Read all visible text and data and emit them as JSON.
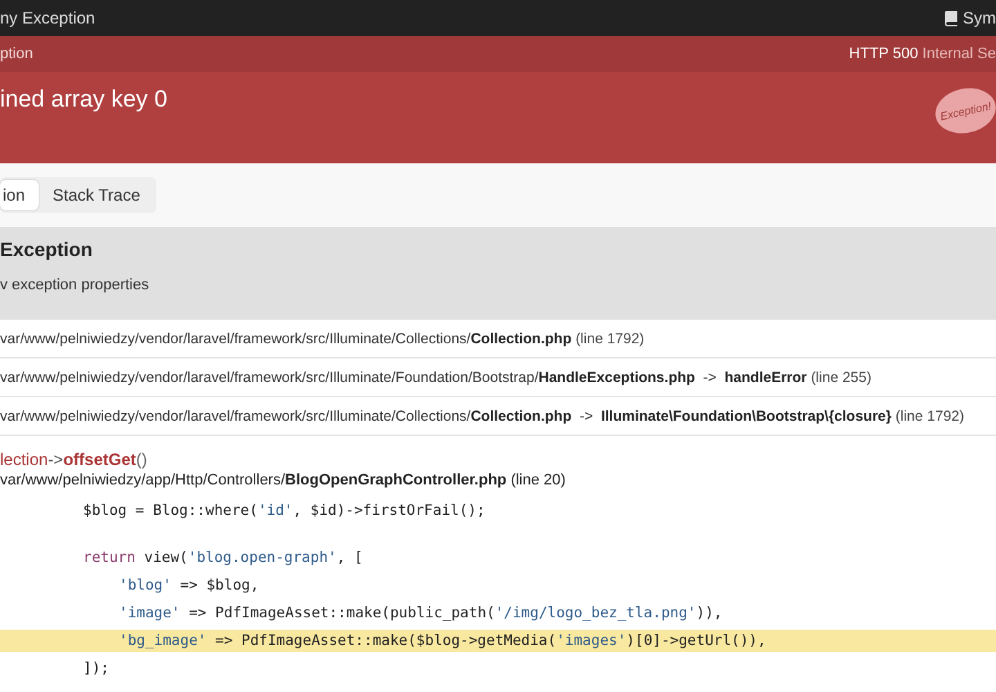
{
  "top_bar": {
    "title": "ny Exception",
    "link": "Sym"
  },
  "header": {
    "subtitle": "ption",
    "status_code": "HTTP 500",
    "status_text": "Internal Se",
    "message": "ined array key 0",
    "logo_text": "Exception!"
  },
  "tabs": [
    {
      "label": "ion",
      "selected": true
    },
    {
      "label": "Stack Trace",
      "selected": false
    }
  ],
  "exception": {
    "title": "Exception",
    "toggle": "v exception properties"
  },
  "trace_rows": [
    {
      "path": "var/www/pelniwiedzy/vendor/laravel/framework/src/Illuminate/Collections/",
      "file": "Collection.php",
      "arrow": "",
      "function": "",
      "line": "(line 1792)"
    },
    {
      "path": "var/www/pelniwiedzy/vendor/laravel/framework/src/Illuminate/Foundation/Bootstrap/",
      "file": "HandleExceptions.php",
      "arrow": "->",
      "function": "handleError",
      "line": "(line 255)"
    },
    {
      "path": "var/www/pelniwiedzy/vendor/laravel/framework/src/Illuminate/Collections/",
      "file": "Collection.php",
      "arrow": "->",
      "function": "Illuminate\\Foundation\\Bootstrap\\{closure}",
      "line": "(line 1792)"
    }
  ],
  "frame": {
    "class": "lection",
    "arrow": "->",
    "method": "offsetGet",
    "args": "()",
    "path": "var/www/pelniwiedzy/app/Http/Controllers/",
    "file": "BlogOpenGraphController.php",
    "line": "(line 20)",
    "code": [
      {
        "highlighted": false,
        "blank_before": false,
        "tokens": [
          {
            "t": "$blog = Blog::where(",
            "kind": "plain"
          },
          {
            "t": "'id'",
            "kind": "string"
          },
          {
            "t": ", $id)->firstOrFail();",
            "kind": "plain"
          }
        ]
      },
      {
        "highlighted": false,
        "blank_before": true,
        "tokens": [
          {
            "t": "return",
            "kind": "keyword"
          },
          {
            "t": " view(",
            "kind": "plain"
          },
          {
            "t": "'blog.open-graph'",
            "kind": "string"
          },
          {
            "t": ", [",
            "kind": "plain"
          }
        ],
        "children": [
          {
            "highlighted": false,
            "tokens": [
              {
                "t": "'blog'",
                "kind": "string"
              },
              {
                "t": " => $blog,",
                "kind": "plain"
              }
            ]
          },
          {
            "highlighted": false,
            "tokens": [
              {
                "t": "'image'",
                "kind": "string"
              },
              {
                "t": " => PdfImageAsset::make(public_path(",
                "kind": "plain"
              },
              {
                "t": "'/img/logo_bez_tla.png'",
                "kind": "string"
              },
              {
                "t": ")),",
                "kind": "plain"
              }
            ]
          },
          {
            "highlighted": true,
            "tokens": [
              {
                "t": "'bg_image'",
                "kind": "string"
              },
              {
                "t": " => PdfImageAsset::make($blog->getMedia(",
                "kind": "plain"
              },
              {
                "t": "'images'",
                "kind": "string"
              },
              {
                "t": ")[0]->getUrl()),",
                "kind": "plain"
              }
            ]
          }
        ]
      },
      {
        "highlighted": false,
        "blank_before": false,
        "tokens": [
          {
            "t": "]);",
            "kind": "plain"
          }
        ]
      }
    ]
  }
}
